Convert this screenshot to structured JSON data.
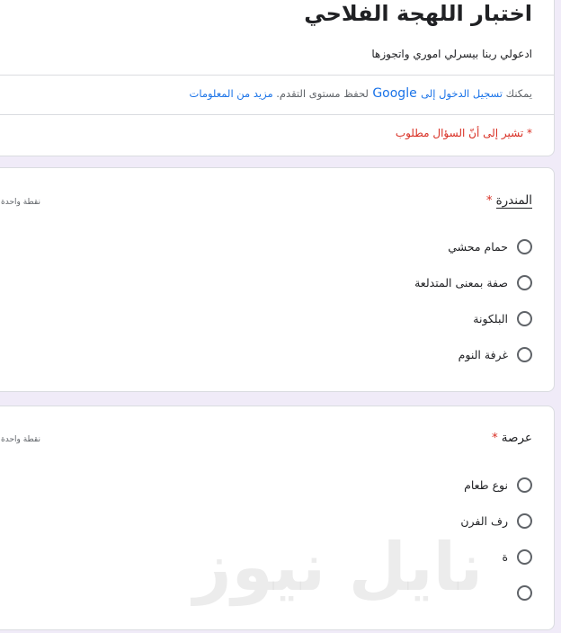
{
  "form": {
    "title": "اختبار اللهجة الفلاحي",
    "description": "ادعولي ربنا بيسرلي اموري واتجوزها",
    "signin_prefix": "يمكنك ",
    "signin_link": "تسجيل الدخول إلى",
    "signin_google": " Google ",
    "signin_middle": "لحفظ مستوى التقدم. ",
    "more_info_link": "مزيد من المعلومات",
    "required_note": "* تشير إلى أنّ السؤال مطلوب"
  },
  "questions": [
    {
      "title": "المندرة",
      "required_mark": "*",
      "points": "نقطة واحدة",
      "options": [
        "حمام محشي",
        "صفة بمعنى المتدلعة",
        "البلكونة",
        "غرفة النوم"
      ]
    },
    {
      "title": "عرصة",
      "required_mark": "*",
      "points": "نقطة واحدة",
      "options": [
        "نوع طعام",
        "رف الفرن",
        "ة",
        ""
      ]
    }
  ],
  "watermark": "نايل نيوز",
  "colors": {
    "background": "#f0ebf8",
    "link": "#1a73e8",
    "required": "#d93025",
    "border": "#dadce0"
  }
}
